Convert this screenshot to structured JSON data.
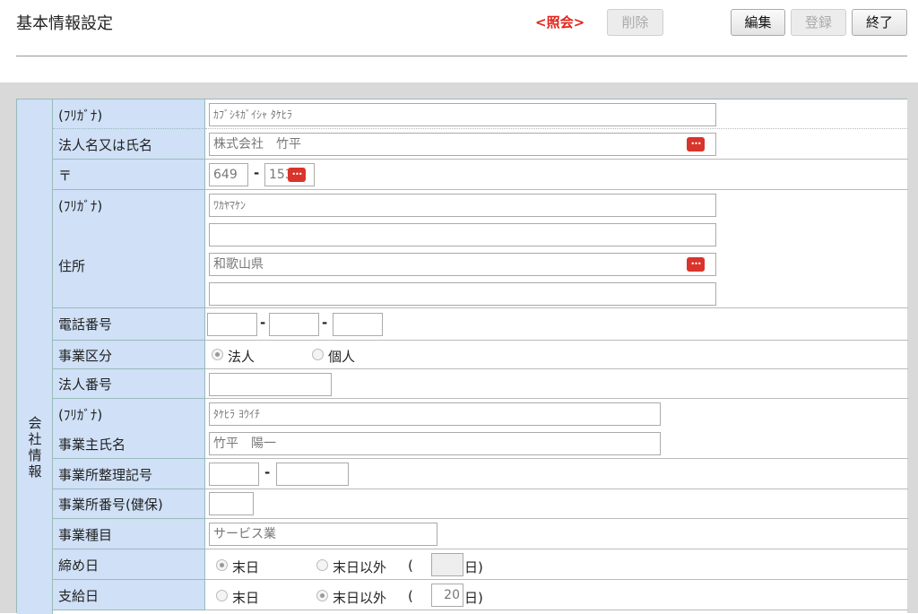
{
  "header": {
    "title": "基本情報設定",
    "mode": "<照会>",
    "buttons": {
      "delete": "削除",
      "edit": "編集",
      "register": "登録",
      "close": "終了"
    }
  },
  "section": {
    "label": "会社情報"
  },
  "fields": {
    "corp_kana": {
      "label": "(ﾌﾘｶﾞﾅ)",
      "value": "ｶﾌﾞｼｷｶﾞｲｼｬ ﾀｹﾋﾗ"
    },
    "corp_name": {
      "label": "法人名又は氏名",
      "value": "株式会社　竹平"
    },
    "postal": {
      "label": "〒",
      "value1": "649",
      "value2": "153"
    },
    "address_kana": {
      "label": "(ﾌﾘｶﾞﾅ)",
      "value": "ﾜｶﾔﾏｹﾝ",
      "value2": ""
    },
    "address": {
      "label": "住所",
      "value": "和歌山県",
      "value2": ""
    },
    "phone": {
      "label": "電話番号",
      "value1": "",
      "value2": "",
      "value3": ""
    },
    "business_type": {
      "label": "事業区分",
      "options": [
        "法人",
        "個人"
      ],
      "selected": "法人"
    },
    "corp_number": {
      "label": "法人番号",
      "value": ""
    },
    "owner_kana": {
      "label": "(ﾌﾘｶﾞﾅ)",
      "value": "ﾀｹﾋﾗ ﾖｳｲﾁ"
    },
    "owner_name": {
      "label": "事業主氏名",
      "value": "竹平　陽一"
    },
    "office_code": {
      "label": "事業所整理記号",
      "value1": "",
      "value2": ""
    },
    "office_number": {
      "label": "事業所番号(健保)",
      "value": ""
    },
    "industry": {
      "label": "事業種目",
      "value": "サービス業"
    },
    "closing_day": {
      "label": "締め日",
      "options": [
        "末日",
        "末日以外"
      ],
      "selected": "末日",
      "paren_open": "(",
      "day_value": "",
      "day_suffix": "日)"
    },
    "pay_day": {
      "label": "支給日",
      "options": [
        "末日",
        "末日以外"
      ],
      "selected": "末日以外",
      "paren_open": "(",
      "day_value": "20",
      "day_suffix": "日)"
    }
  },
  "colors": {
    "accent_red": "#e2231a",
    "label_bg": "#cfe0f7",
    "band_gray": "#d9d9d9"
  }
}
